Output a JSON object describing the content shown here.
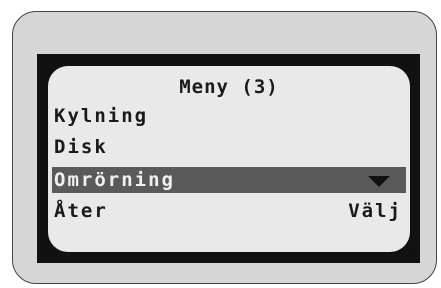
{
  "menu": {
    "title": "Meny (3)",
    "items": [
      {
        "label": "Kylning"
      },
      {
        "label": "Disk"
      },
      {
        "label": "Omrörning",
        "selected": true
      }
    ]
  },
  "softkeys": {
    "left": "Åter",
    "right": "Välj"
  },
  "icons": {
    "selected_indicator": "triangle-down-icon"
  },
  "colors": {
    "screen_background": "#e9e9e9",
    "bezel": "#111111",
    "selection_highlight": "#5a5a5a",
    "device_body": "#d6d6d6"
  }
}
